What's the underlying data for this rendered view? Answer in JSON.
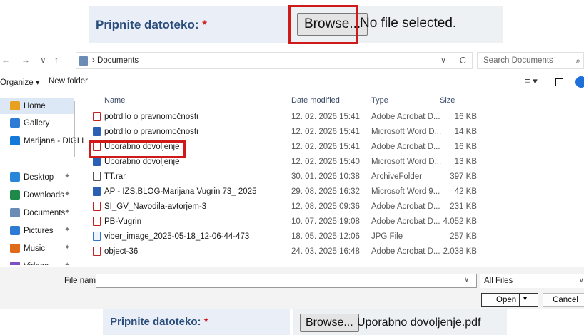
{
  "form_top": {
    "label": "Pripnite datoteko:",
    "required_mark": "*",
    "browse_label": "Browse...",
    "status": "No file selected."
  },
  "dialog": {
    "nav": {
      "back": "←",
      "forward": "→",
      "recent": "∨",
      "up": "↑"
    },
    "breadcrumb": "› Documents",
    "path_dropdown": "∨",
    "refresh": "C",
    "search_placeholder": "Search Documents",
    "search_icon": "⌕",
    "toolbar": {
      "organize": "Organize ▾",
      "new_folder": "New folder",
      "views": "≡ ▾"
    },
    "sidebar": [
      {
        "label": "Home",
        "icon": "home-icon",
        "color": "#e8a020",
        "active": true,
        "pinned": false
      },
      {
        "label": "Gallery",
        "icon": "gallery-icon",
        "color": "#2e7bd6",
        "active": false,
        "pinned": false
      },
      {
        "label": "Marijana - DIGI I",
        "icon": "onedrive-icon",
        "color": "#1479d9",
        "active": false,
        "pinned": false
      },
      {
        "label": "Desktop",
        "icon": "desktop-icon",
        "color": "#2a86d8",
        "active": false,
        "pinned": true
      },
      {
        "label": "Downloads",
        "icon": "downloads-icon",
        "color": "#1e8a4a",
        "active": false,
        "pinned": true
      },
      {
        "label": "Documents",
        "icon": "documents-icon",
        "color": "#6b8db5",
        "active": false,
        "pinned": true
      },
      {
        "label": "Pictures",
        "icon": "pictures-icon",
        "color": "#2e7bd6",
        "active": false,
        "pinned": true
      },
      {
        "label": "Music",
        "icon": "music-icon",
        "color": "#e06a1a",
        "active": false,
        "pinned": true
      },
      {
        "label": "Videos",
        "icon": "videos-icon",
        "color": "#7a4fc7",
        "active": false,
        "pinned": true
      }
    ],
    "pin_glyph": "✦",
    "columns": {
      "name": "Name",
      "date": "Date modified",
      "type": "Type",
      "size": "Size"
    },
    "files": [
      {
        "name": "potrdilo o pravnomočnosti",
        "date": "12. 02. 2026 15:41",
        "type": "Adobe Acrobat D...",
        "size": "16 KB",
        "kind": "pdf"
      },
      {
        "name": "potrdilo o pravnomočnosti",
        "date": "12. 02. 2026 15:41",
        "type": "Microsoft Word D...",
        "size": "14 KB",
        "kind": "word"
      },
      {
        "name": "Uporabno dovoljenje",
        "date": "12. 02. 2026 15:41",
        "type": "Adobe Acrobat D...",
        "size": "16 KB",
        "kind": "pdf"
      },
      {
        "name": "Uporabno dovoljenje",
        "date": "12. 02. 2026 15:40",
        "type": "Microsoft Word D...",
        "size": "13 KB",
        "kind": "word"
      },
      {
        "name": "TT.rar",
        "date": "30. 01. 2026 10:38",
        "type": "ArchiveFolder",
        "size": "397 KB",
        "kind": "rar"
      },
      {
        "name": "AP - IZS.BLOG-Marijana Vugrin 73_ 2025",
        "date": "29. 08. 2025 16:32",
        "type": "Microsoft Word 9...",
        "size": "42 KB",
        "kind": "word"
      },
      {
        "name": "SI_GV_Navodila-avtorjem-3",
        "date": "12. 08. 2025 09:36",
        "type": "Adobe Acrobat D...",
        "size": "231 KB",
        "kind": "pdf"
      },
      {
        "name": "PB-Vugrin",
        "date": "10. 07. 2025 19:08",
        "type": "Adobe Acrobat D...",
        "size": "4.052 KB",
        "kind": "pdf"
      },
      {
        "name": "viber_image_2025-05-18_12-06-44-473",
        "date": "18. 05. 2025 12:06",
        "type": "JPG File",
        "size": "257 KB",
        "kind": "jpg"
      },
      {
        "name": "object-36",
        "date": "24. 03. 2025 16:48",
        "type": "Adobe Acrobat D...",
        "size": "2.038 KB",
        "kind": "pdf"
      }
    ],
    "file_name_label": "File name:",
    "file_name_value": "",
    "filter": "All Files",
    "open_label": "Open",
    "cancel_label": "Cancel",
    "dropdown_glyph": "∨"
  },
  "form_bottom": {
    "label": "Pripnite datoteko:",
    "required_mark": "*",
    "browse_label": "Browse...",
    "selected_file": "Uporabno dovoljenje.pdf"
  },
  "colors": {
    "highlight_red": "#d01a1a",
    "form_label_blue": "#2a4d7a",
    "selection_blue": "#dde8f6",
    "pdf_red": "#c42020",
    "word_blue": "#2b5fb4"
  }
}
